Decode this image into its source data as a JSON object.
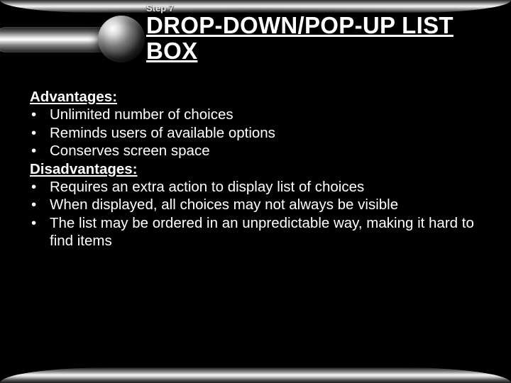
{
  "kicker": "Step 7",
  "title": "DROP-DOWN/POP-UP LIST BOX",
  "sections": {
    "adv_heading": "Advantages:",
    "adv": [
      "Unlimited number of choices",
      "Reminds users of available options",
      "Conserves screen space"
    ],
    "dis_heading": "Disadvantages:",
    "dis": [
      "Requires an extra action to display list of choices",
      "When displayed, all choices may not always be visible",
      "The list may be ordered in an unpredictable way, making it hard to find items"
    ]
  },
  "bullet": "•"
}
